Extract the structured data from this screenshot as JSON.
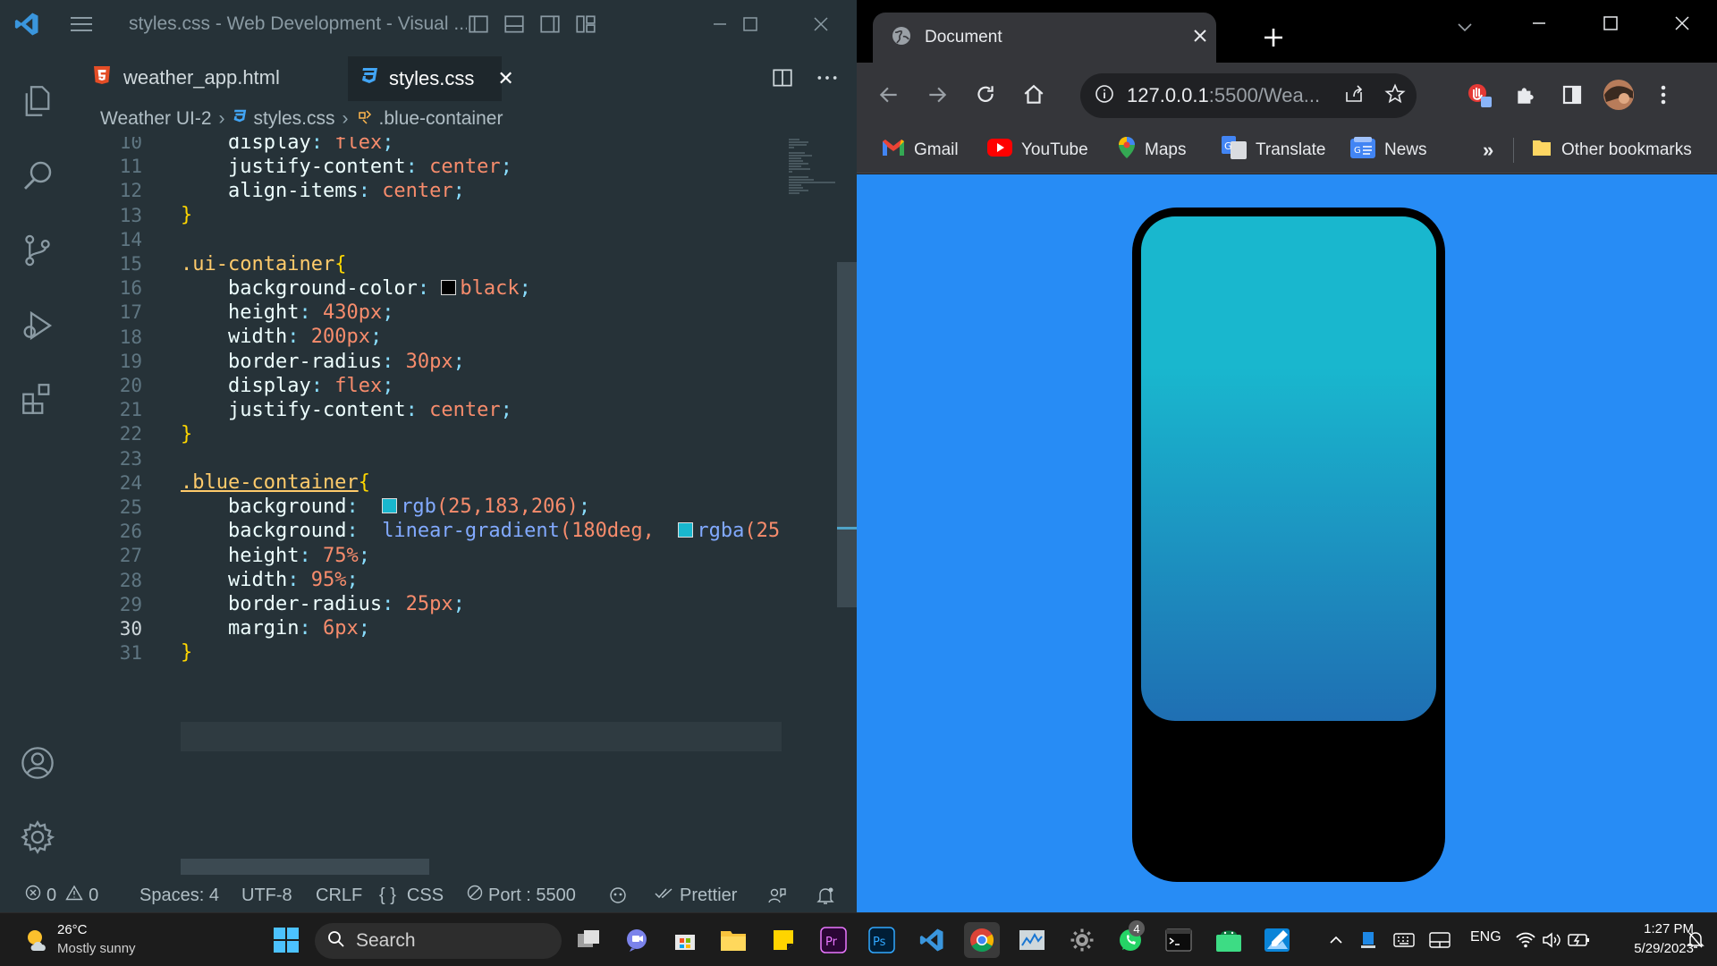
{
  "vscode": {
    "window_title": "styles.css - Web Development - Visual ...",
    "tabs": [
      {
        "label": "weather_app.html",
        "icon": "html5-icon"
      },
      {
        "label": "styles.css",
        "icon": "css3-icon",
        "close": "✕"
      }
    ],
    "breadcrumb": {
      "folder": "Weather UI-2",
      "file": "styles.css",
      "symbol": ".blue-container"
    },
    "line_numbers": [
      "10",
      "11",
      "12",
      "13",
      "14",
      "15",
      "16",
      "17",
      "18",
      "19",
      "20",
      "21",
      "22",
      "23",
      "24",
      "25",
      "26",
      "27",
      "28",
      "29",
      "30",
      "31"
    ],
    "code": {
      "l10_prop": "display",
      "l10_val": "flex",
      "l11_prop": "justify-content",
      "l11_val": "center",
      "l12_prop": "align-items",
      "l12_val": "center",
      "l15_sel": ".ui-container",
      "l16_prop": "background-color",
      "l16_val": "black",
      "l17_prop": "height",
      "l17_val": "430px",
      "l18_prop": "width",
      "l18_val": "200px",
      "l19_prop": "border-radius",
      "l19_val": "30px",
      "l20_prop": "display",
      "l20_val": "flex",
      "l21_prop": "justify-content",
      "l21_val": "center",
      "l24_sel": ".blue-container",
      "l25_prop": "background",
      "l25_fn": "rgb",
      "l25_args": "(25,183,206)",
      "l26_prop": "background",
      "l26_fn": "linear-gradient",
      "l26_arg": "(180deg,",
      "l26_fn2": "rgba",
      "l26_tail": "(25,",
      "l27_prop": "height",
      "l27_val": "75%",
      "l28_prop": "width",
      "l28_val": "95%",
      "l29_prop": "border-radius",
      "l29_val": "25px",
      "l30_prop": "margin",
      "l30_val": "6px"
    },
    "colors": {
      "swatch_black": "#000000",
      "swatch_teal": "#19b7ce",
      "accent": "#3a96dd"
    },
    "status": {
      "errors": "0",
      "warnings": "0",
      "spaces": "Spaces: 4",
      "encoding": "UTF-8",
      "eol": "CRLF",
      "language": "CSS",
      "port": "Port : 5500",
      "prettier": "Prettier"
    }
  },
  "chrome": {
    "tab_title": "Document",
    "url": "127.0.0.1:5500/Wea...",
    "url_host": "127.0.0.1",
    "url_rest": ":5500/Wea...",
    "bookmarks": [
      {
        "label": "Gmail",
        "icon": "gmail-icon"
      },
      {
        "label": "YouTube",
        "icon": "youtube-icon"
      },
      {
        "label": "Maps",
        "icon": "maps-icon"
      },
      {
        "label": "Translate",
        "icon": "translate-icon"
      },
      {
        "label": "News",
        "icon": "news-icon"
      }
    ],
    "more_bookmarks": "»",
    "other_bookmarks": "Other bookmarks",
    "page": {
      "background": "#278cf5",
      "container_color": "#000000",
      "gradient_top": "#19b7ce",
      "gradient_bottom": "#1f6fb3"
    }
  },
  "taskbar": {
    "weather_temp": "26°C",
    "weather_desc": "Mostly sunny",
    "search_placeholder": "Search",
    "whatsapp_badge": "4",
    "language": "ENG",
    "time": "1:27 PM",
    "date": "5/29/2023"
  }
}
